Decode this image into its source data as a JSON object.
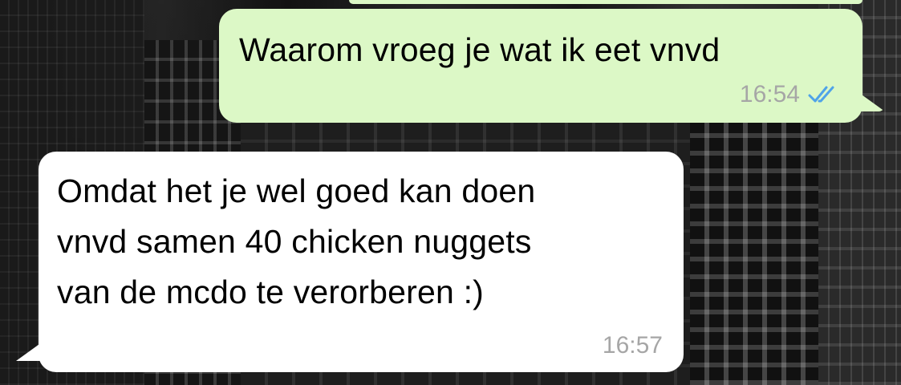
{
  "chat": {
    "messages": [
      {
        "direction": "outgoing",
        "text": "Waarom vroeg je wat ik eet vnvd",
        "time": "16:54",
        "status_icon": "double-check-read-icon",
        "bubble_color": "#dcf8c6",
        "tick_color": "#4fa3e8"
      },
      {
        "direction": "incoming",
        "text": "Omdat het je wel goed kan doen\nvnvd samen 40 chicken nuggets\nvan de mcdo te verorberen :)",
        "time": "16:57",
        "bubble_color": "#ffffff"
      }
    ]
  }
}
